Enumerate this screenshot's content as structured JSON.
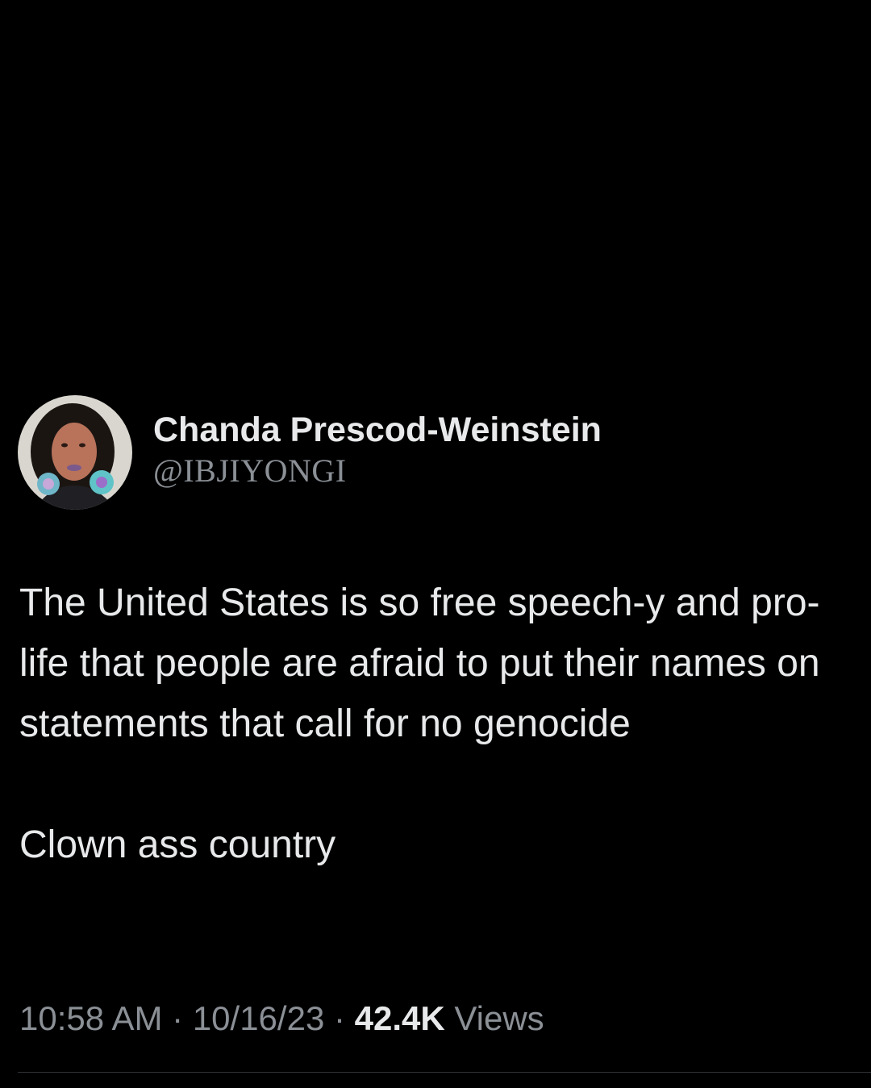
{
  "tweet": {
    "author": {
      "display_name": "Chanda Prescod-Weinstein",
      "handle": "@IBJIYONGI",
      "avatar_icon": "profile-photo"
    },
    "text_paragraphs": [
      "The United States is so free speech-y and pro-life that people are afraid to put their names on statements that call for no genocide",
      "Clown ass country"
    ],
    "meta": {
      "time": "10:58 AM",
      "separator": "·",
      "date": "10/16/23",
      "views_count": "42.4K",
      "views_label": "Views"
    }
  },
  "colors": {
    "background": "#000000",
    "primary_text": "#e7e9ea",
    "secondary_text": "#8b9096",
    "divider": "#2f3336"
  }
}
